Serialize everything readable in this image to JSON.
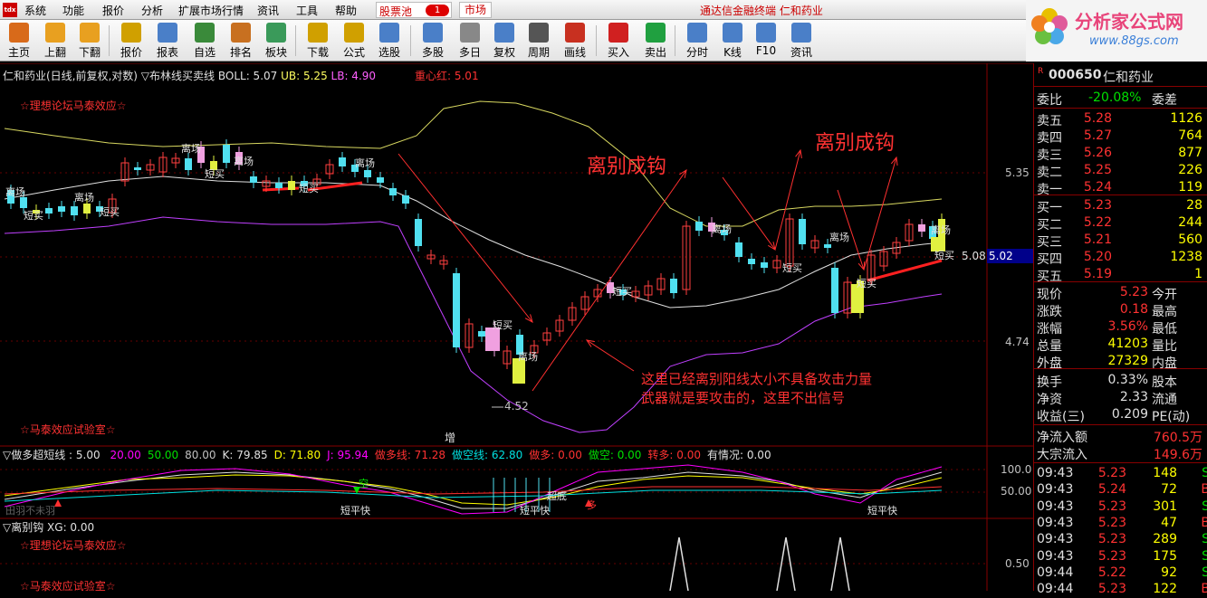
{
  "menubar": {
    "app_icon": "tdx",
    "items": [
      "系统",
      "功能",
      "报价",
      "分析",
      "扩展市场行情",
      "资讯",
      "工具",
      "帮助"
    ],
    "pool_label": "股票池",
    "pool_badge": "1",
    "market_tab": "市场",
    "brand": "通达信金融终端  仁和药业"
  },
  "logo": {
    "title": "分析家公式网",
    "url": "www.88gs.com"
  },
  "toolbar": {
    "buttons": [
      {
        "label": "主页",
        "icon": "home-icon",
        "color": "#d86a1a"
      },
      {
        "label": "上翻",
        "icon": "arrow-up-icon",
        "color": "#e8a020"
      },
      {
        "label": "下翻",
        "icon": "arrow-down-icon",
        "color": "#e8a020"
      },
      {
        "label": "报价",
        "icon": "quote-icon",
        "color": "#d0a000"
      },
      {
        "label": "报表",
        "icon": "report-icon",
        "color": "#4a7fc8"
      },
      {
        "label": "自选",
        "icon": "f6-icon",
        "color": "#3a8a3a"
      },
      {
        "label": "排名",
        "icon": "rank-icon",
        "color": "#c87020"
      },
      {
        "label": "板块",
        "icon": "sector-icon",
        "color": "#3a9a5a"
      },
      {
        "label": "下载",
        "icon": "download-icon",
        "color": "#d0a000"
      },
      {
        "label": "公式",
        "icon": "formula-icon",
        "color": "#d0a000"
      },
      {
        "label": "选股",
        "icon": "pick-icon",
        "color": "#4a7fc8"
      },
      {
        "label": "多股",
        "icon": "multi-icon",
        "color": "#4a7fc8"
      },
      {
        "label": "多日",
        "icon": "clock-icon",
        "color": "#888888"
      },
      {
        "label": "复权",
        "icon": "adjust-icon",
        "color": "#4a7fc8"
      },
      {
        "label": "周期",
        "icon": "f8-icon",
        "color": "#555555"
      },
      {
        "label": "画线",
        "icon": "draw-icon",
        "color": "#c83020"
      },
      {
        "label": "买入",
        "icon": "buy-icon",
        "color": "#d02020"
      },
      {
        "label": "卖出",
        "icon": "sell-icon",
        "color": "#20a040"
      },
      {
        "label": "分时",
        "icon": "intraday-icon",
        "color": "#4a7fc8"
      },
      {
        "label": "K线",
        "icon": "kline-icon",
        "color": "#4a7fc8"
      },
      {
        "label": "F10",
        "icon": "f10-icon",
        "color": "#4a7fc8"
      },
      {
        "label": "资讯",
        "icon": "news-icon",
        "color": "#4a7fc8"
      }
    ]
  },
  "main_chart": {
    "title": "仁和药业(日线,前复权,对数) ▽布林线买卖线  BOLL: 5.07  UB: 5.25  LB: 4.90",
    "boll_label": "BOLL: 5.07",
    "ub_label": "UB: 5.25",
    "lb_label": "LB: 4.90",
    "title_prefix": "仁和药业(日线,前复权,对数) ▽布林线买卖线 ",
    "center_label": "重心红: 5.01",
    "watermark_top": "☆理想论坛马泰效应☆",
    "watermark_bottom": "☆马泰效应试验室☆",
    "y_ticks": [
      "5.35",
      "5.08",
      "4.74"
    ],
    "current_price_tag": "5.02",
    "callout_1": "离别成钩",
    "callout_2": "离别成钩",
    "note_line1": "这里已经离别阳线太小不具备攻击力量",
    "note_line2": "武器就是要攻击的，这里不出信号",
    "low_label": "4.52",
    "mid_label": "5.08",
    "signal_labels": [
      "离场",
      "短买",
      "离场",
      "短买",
      "离场",
      "短买",
      "离场",
      "短买",
      "离场",
      "短买",
      "离场",
      "短买",
      "离场",
      "短买"
    ],
    "x_marker": "增"
  },
  "indicator1": {
    "title": "▽做多超短线 : 5.00",
    "values": [
      {
        "text": "20.00",
        "color": "#ff00ff"
      },
      {
        "text": "50.00",
        "color": "#00e000"
      },
      {
        "text": "80.00",
        "color": "#c0c0c0"
      },
      {
        "text": "K: 79.85",
        "color": "#e0e0e0"
      },
      {
        "text": "D: 71.80",
        "color": "#ffff00"
      },
      {
        "text": "J: 95.94",
        "color": "#ff00ff"
      },
      {
        "text": "做多线: 71.28",
        "color": "#ff3232"
      },
      {
        "text": "做空线: 62.80",
        "color": "#00e0e0"
      },
      {
        "text": "做多: 0.00",
        "color": "#ff3232"
      },
      {
        "text": "做空: 0.00",
        "color": "#00e000"
      },
      {
        "text": "转多: 0.00",
        "color": "#ff3232"
      },
      {
        "text": "有情况: 0.00",
        "color": "#e0e0e0"
      }
    ],
    "y_ticks": [
      "100.0",
      "50.00"
    ],
    "labels": [
      "空",
      "短平快",
      "短平快",
      "短平快",
      "超底",
      "多"
    ]
  },
  "indicator2": {
    "title": "▽离别钩  XG: 0.00",
    "watermark_top": "☆理想论坛马泰效应☆",
    "watermark_bottom": "☆马泰效应试验室☆",
    "y_ticks": [
      "0.50"
    ],
    "x_label": "田羽不未羽"
  },
  "quote_panel": {
    "code": "000650",
    "name": "仁和药业",
    "webi_label": "委比",
    "webi_value": "-20.08%",
    "weicha_label": "委差",
    "asks": [
      {
        "label": "卖五",
        "price": "5.28",
        "vol": "1126"
      },
      {
        "label": "卖四",
        "price": "5.27",
        "vol": "764"
      },
      {
        "label": "卖三",
        "price": "5.26",
        "vol": "877"
      },
      {
        "label": "卖二",
        "price": "5.25",
        "vol": "226"
      },
      {
        "label": "卖一",
        "price": "5.24",
        "vol": "119"
      }
    ],
    "bids": [
      {
        "label": "买一",
        "price": "5.23",
        "vol": "28"
      },
      {
        "label": "买二",
        "price": "5.22",
        "vol": "244"
      },
      {
        "label": "买三",
        "price": "5.21",
        "vol": "560"
      },
      {
        "label": "买四",
        "price": "5.20",
        "vol": "1238"
      },
      {
        "label": "买五",
        "price": "5.19",
        "vol": "1"
      }
    ],
    "stats": [
      {
        "l1": "现价",
        "v1": "5.23",
        "l2": "今开"
      },
      {
        "l1": "涨跌",
        "v1": "0.18",
        "l2": "最高"
      },
      {
        "l1": "涨幅",
        "v1": "3.56%",
        "l2": "最低"
      },
      {
        "l1": "总量",
        "v1": "41203",
        "l2": "量比"
      },
      {
        "l1": "外盘",
        "v1": "27329",
        "l2": "内盘"
      }
    ],
    "stats2": [
      {
        "l1": "换手",
        "v1": "0.33%",
        "l2": "股本"
      },
      {
        "l1": "净资",
        "v1": "2.33",
        "l2": "流通"
      },
      {
        "l1": "收益(三)",
        "v1": "0.209",
        "l2": "PE(动)"
      }
    ],
    "flows": [
      {
        "label": "净流入额",
        "value": "760.5万"
      },
      {
        "label": "大宗流入",
        "value": "149.6万"
      }
    ],
    "ticks": [
      {
        "time": "09:43",
        "price": "5.23",
        "vol": "148",
        "side": "S"
      },
      {
        "time": "09:43",
        "price": "5.24",
        "vol": "72",
        "side": "B"
      },
      {
        "time": "09:43",
        "price": "5.23",
        "vol": "301",
        "side": "S"
      },
      {
        "time": "09:43",
        "price": "5.23",
        "vol": "47",
        "side": "B"
      },
      {
        "time": "09:43",
        "price": "5.23",
        "vol": "289",
        "side": "S"
      },
      {
        "time": "09:43",
        "price": "5.23",
        "vol": "175",
        "side": "S"
      },
      {
        "time": "09:44",
        "price": "5.22",
        "vol": "92",
        "side": "S"
      },
      {
        "time": "09:44",
        "price": "5.23",
        "vol": "122",
        "side": "B"
      }
    ]
  }
}
